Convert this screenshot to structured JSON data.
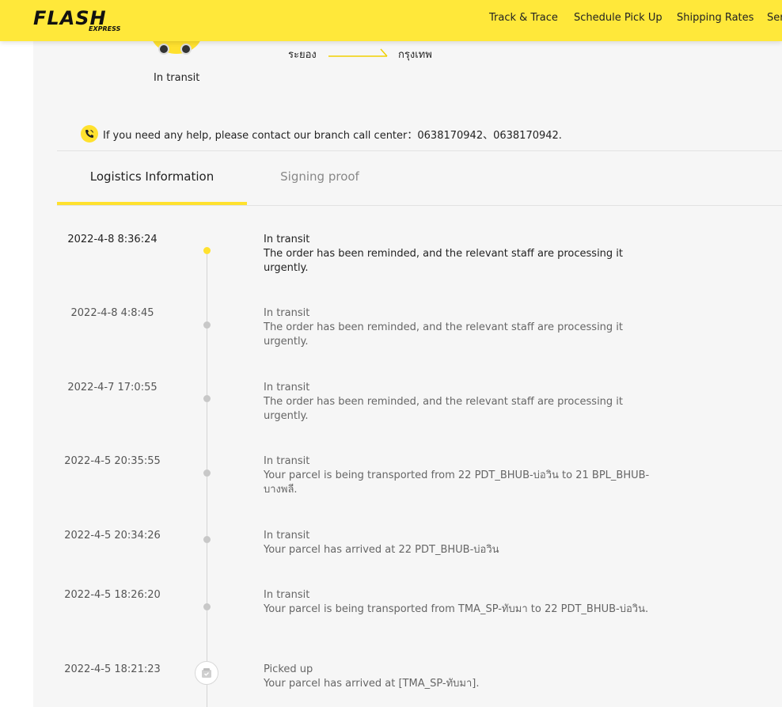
{
  "header": {
    "logo": "FLASH",
    "logo_sub": "EXPRESS",
    "nav": [
      "Track & Trace",
      "Schedule Pick Up",
      "Shipping Rates",
      "Ser"
    ]
  },
  "shipment": {
    "status": "In transit",
    "route_from": "ระยอง",
    "route_to": "กรุงเทพ"
  },
  "help_text": "If you need any help, please contact our branch call center：0638170942、0638170942.",
  "tabs": [
    "Logistics Information",
    "Signing proof"
  ],
  "events": [
    {
      "time": "2022-4-8 8:36:24",
      "status": "In transit",
      "desc": "The order has been reminded, and the relevant staff are processing it urgently."
    },
    {
      "time": "2022-4-8 4:8:45",
      "status": "In transit",
      "desc": "The order has been reminded, and the relevant staff are processing it urgently."
    },
    {
      "time": "2022-4-7 17:0:55",
      "status": "In transit",
      "desc": "The order has been reminded, and the relevant staff are processing it urgently."
    },
    {
      "time": "2022-4-5 20:35:55",
      "status": "In transit",
      "desc": "Your parcel is being transported from 22 PDT_BHUB-บ่อวิน to 21 BPL_BHUB-บางพลี."
    },
    {
      "time": "2022-4-5 20:34:26",
      "status": "In transit",
      "desc": "Your parcel has arrived at 22 PDT_BHUB-บ่อวิน"
    },
    {
      "time": "2022-4-5 18:26:20",
      "status": "In transit",
      "desc": "Your parcel is being transported from TMA_SP-ทับมา to 22 PDT_BHUB-บ่อวิน."
    },
    {
      "time": "2022-4-5 18:21:23",
      "status": "Picked up",
      "desc": "Your parcel has arrived at [TMA_SP-ทับมา]."
    }
  ],
  "colors": {
    "brand_yellow": "#ffe83a",
    "accent_yellow": "#ffe12e",
    "card_bg": "#f6f6f6"
  }
}
